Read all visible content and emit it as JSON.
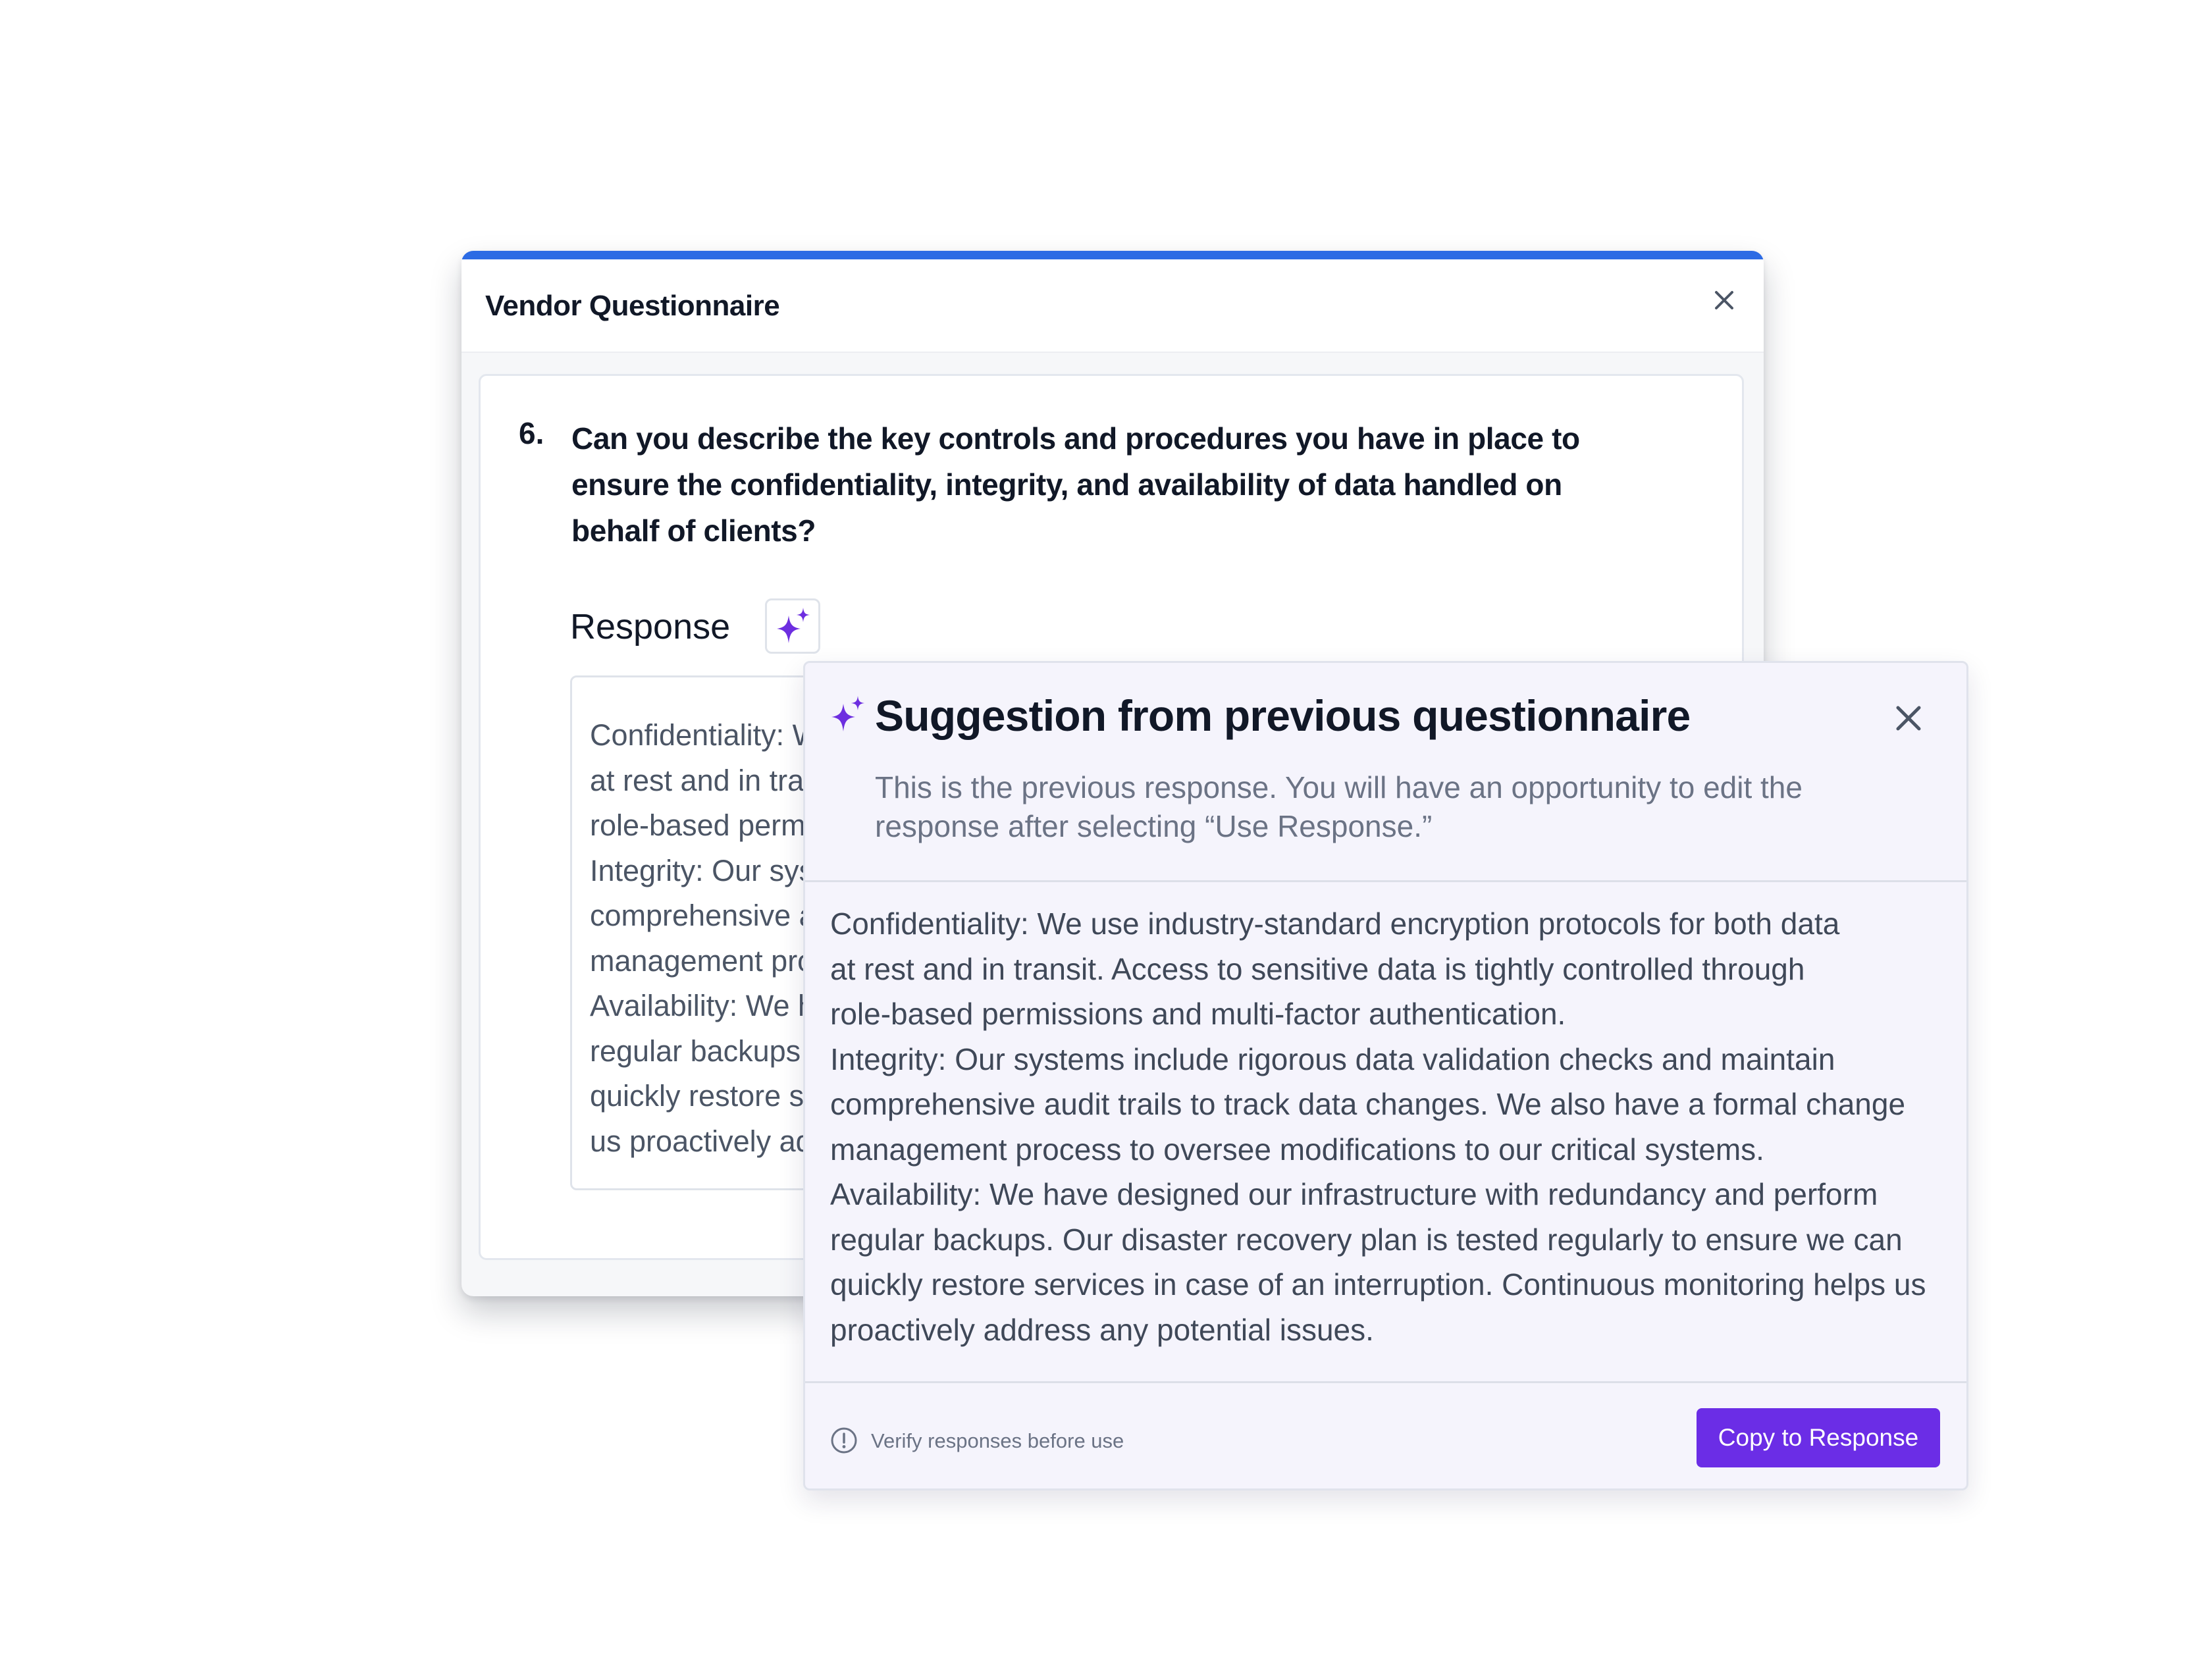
{
  "window": {
    "title": "Vendor Questionnaire",
    "accent_color": "#2c6be4",
    "close_icon": "close-icon"
  },
  "question": {
    "number": "6.",
    "lines": [
      "Can you describe the key controls and procedures you have in place to",
      "ensure the confidentiality, integrity, and availability of data handled on",
      "behalf of clients?"
    ]
  },
  "response": {
    "label": "Response",
    "ai_icon": "sparkles-icon",
    "lines": [
      "Confidentiality: We use industry-standard encryption protocols for both data",
      "at rest and in transit. Access to sensitive data is tightly controlled through",
      " role-based permissions and multi-factor authentication.",
      "Integrity: Our systems include rigorous data validation checks and maintain",
      "comprehensive audit trails to track data changes. We also have a formal change",
      "management process to oversee modifications to our critical systems.",
      "Availability: We have designed our infrastructure with redundancy and perform",
      "regular backups. Our disaster recovery plan is tested regularly to ensure we can",
      "quickly restore services in case of an interruption. Continuous monitoring helps",
      "us proactively address any potential issues."
    ]
  },
  "suggestion": {
    "title": "Suggestion from previous questionnaire",
    "subtitle_lines": [
      "This is the previous response. You will have an opportunity to edit the",
      "response after selecting “Use Response.”"
    ],
    "body_lines": [
      "Confidentiality: We use industry-standard encryption protocols for both data",
      "at rest and in transit. Access to sensitive data is tightly controlled through",
      " role-based permissions and multi-factor authentication.",
      "Integrity: Our systems include rigorous data validation checks and maintain",
      "comprehensive audit trails to track data changes. We also have a formal change",
      "management process to oversee modifications to our critical systems.",
      "Availability: We have designed our infrastructure with redundancy and perform",
      "regular backups. Our disaster recovery plan is tested regularly to ensure we can",
      "quickly restore services in case of an interruption. Continuous monitoring helps us",
      "proactively address any potential issues."
    ],
    "footer_note": "Verify responses before use",
    "footer_icon": "alert-circle-icon",
    "copy_button": "Copy to Response",
    "button_color": "#6b2de6",
    "sparkle_color": "#6d2ee0"
  }
}
